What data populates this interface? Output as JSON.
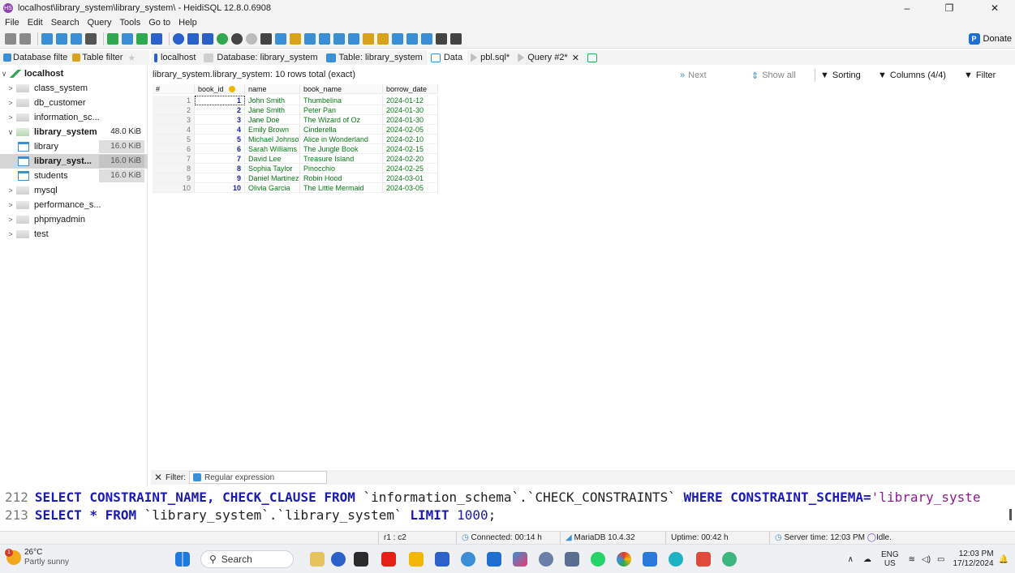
{
  "window": {
    "title": "localhost\\library_system\\library_system\\ - HeidiSQL 12.8.0.6908",
    "app_icon": "HS",
    "minimize": "–",
    "maximize": "❐",
    "close": "✕"
  },
  "menu": [
    "File",
    "Edit",
    "Search",
    "Query",
    "Tools",
    "Go to",
    "Help"
  ],
  "toolbar": {
    "donate_label": "Donate",
    "donate_icon": "P"
  },
  "sidebar_filters": {
    "db_filter": "Database filte",
    "table_filter": "Table filter"
  },
  "tabs": [
    {
      "label": "localhost",
      "color": "#2a62c9"
    },
    {
      "label": "Database: library_system",
      "color": "#cfcfcf"
    },
    {
      "label": "Table: library_system",
      "color": "#3b8fd6"
    },
    {
      "label": "Data",
      "color": "#3b8fd6"
    },
    {
      "label": "pbl.sql*",
      "color": "#bfbfbf"
    },
    {
      "label": "Query #2*",
      "color": "#bfbfbf"
    }
  ],
  "tabs_close": "✕",
  "tree": {
    "root": "localhost",
    "databases": [
      {
        "name": "class_system"
      },
      {
        "name": "db_customer"
      },
      {
        "name": "information_sc..."
      },
      {
        "name": "library_system",
        "size": "48.0 KiB"
      },
      {
        "name": "mysql"
      },
      {
        "name": "performance_s..."
      },
      {
        "name": "phpmyadmin"
      },
      {
        "name": "test"
      }
    ],
    "tables": [
      {
        "name": "library",
        "size": "16.0 KiB"
      },
      {
        "name": "library_syst...",
        "size": "16.0 KiB"
      },
      {
        "name": "students",
        "size": "16.0 KiB"
      }
    ]
  },
  "data_view": {
    "info": "library_system.library_system: 10 rows total (exact)",
    "next": "Next",
    "show_all": "Show all",
    "sorting": "Sorting",
    "columns": "Columns (4/4)",
    "filter": "Filter"
  },
  "grid": {
    "headers": [
      "#",
      "book_id",
      "name",
      "book_name",
      "borrow_date"
    ],
    "rows": [
      [
        "1",
        "1",
        "John Smith",
        "Thumbelina",
        "2024-01-12"
      ],
      [
        "2",
        "2",
        "Jane Smith",
        "Peter Pan",
        "2024-01-30"
      ],
      [
        "3",
        "3",
        "Jane Doe",
        "The Wizard of Oz",
        "2024-01-30"
      ],
      [
        "4",
        "4",
        "Emily Brown",
        "Cinderella",
        "2024-02-05"
      ],
      [
        "5",
        "5",
        "Michael Johnson",
        "Alice in Wonderland",
        "2024-02-10"
      ],
      [
        "6",
        "6",
        "Sarah Williams",
        "The Jungle Book",
        "2024-02-15"
      ],
      [
        "7",
        "7",
        "David Lee",
        "Treasure Island",
        "2024-02-20"
      ],
      [
        "8",
        "8",
        "Sophia Taylor",
        "Pinocchio",
        "2024-02-25"
      ],
      [
        "9",
        "9",
        "Daniel Martinez",
        "Robin Hood",
        "2024-03-01"
      ],
      [
        "10",
        "10",
        "Olivia Garcia",
        "The Little Mermaid",
        "2024-03-05"
      ]
    ]
  },
  "filter_bar": {
    "close": "✕",
    "label": "Filter:",
    "placeholder": "Regular expression"
  },
  "sql_log": {
    "line1_no": "212",
    "line1": {
      "kw1": "SELECT",
      "kw2": "CONSTRAINT_NAME,",
      "kw3": "CHECK_CLAUSE",
      "kw4": "FROM",
      "id1": "`information_schema`.`CHECK_CONSTRAINTS`",
      "kw5": "WHERE",
      "kw6": "CONSTRAINT_SCHEMA=",
      "str1": "'library_syste"
    },
    "line2_no": "213",
    "line2": {
      "kw1": "SELECT",
      "star": "*",
      "kw2": "FROM",
      "id1": "`library_system`.`library_system`",
      "kw3": "LIMIT",
      "num": "1000",
      "end": ";"
    }
  },
  "status": {
    "pos": "r1 : c2",
    "connected": "Connected: 00:14 h",
    "server": "MariaDB 10.4.32",
    "uptime": "Uptime: 00:42 h",
    "server_time": "Server time: 12:03 PM",
    "idle": "Idle."
  },
  "taskbar": {
    "temp": "26°C",
    "weather": "Partly sunny",
    "weather_badge": "1",
    "search": "Search",
    "lang1": "ENG",
    "lang2": "US",
    "time": "12:03 PM",
    "date": "17/12/2024"
  }
}
